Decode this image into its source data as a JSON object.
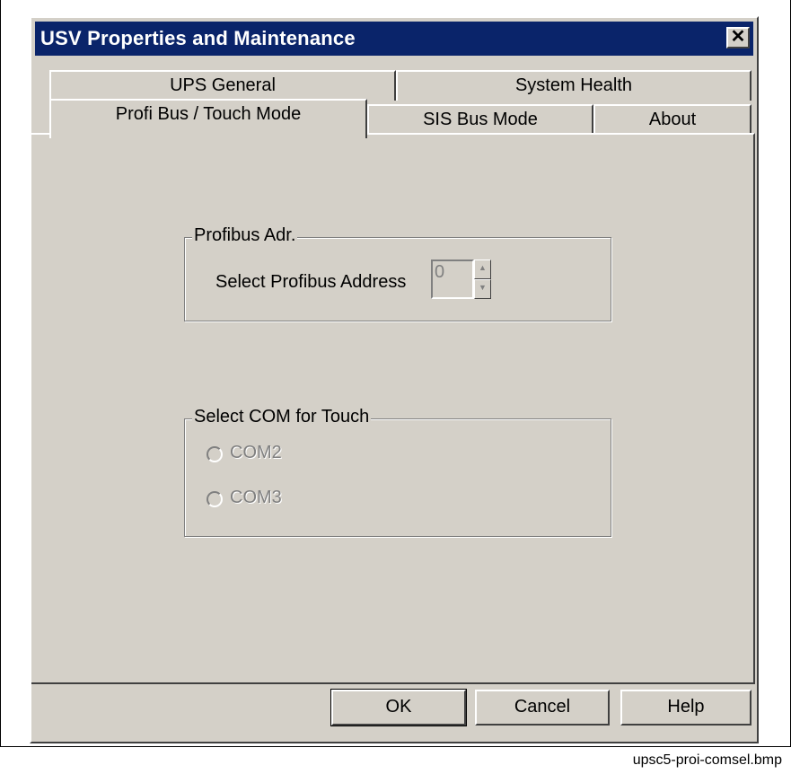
{
  "window": {
    "title": "USV Properties and Maintenance",
    "close_icon_glyph": "✕"
  },
  "tabs": {
    "back_row": [
      {
        "label": "UPS General"
      },
      {
        "label": "System Health"
      }
    ],
    "front_row": [
      {
        "label": "Profi Bus / Touch Mode",
        "selected": true
      },
      {
        "label": "SIS Bus Mode"
      },
      {
        "label": "About"
      }
    ]
  },
  "profibus_group": {
    "legend": "Profibus Adr.",
    "select_label": "Select Profibus Address",
    "address_value": "0",
    "up_arrow": "▲",
    "down_arrow": "▼"
  },
  "com_group": {
    "legend": "Select COM for Touch",
    "options": [
      {
        "label": "COM2",
        "checked": false,
        "disabled": true
      },
      {
        "label": "COM3",
        "checked": false,
        "disabled": true
      }
    ]
  },
  "buttons": {
    "ok": "OK",
    "cancel": "Cancel",
    "help": "Help"
  },
  "caption": "upsc5-proi-comsel.bmp",
  "colors": {
    "titlebar": "#0a246a",
    "face": "#d4d0c8",
    "disabled_text": "#808080"
  }
}
